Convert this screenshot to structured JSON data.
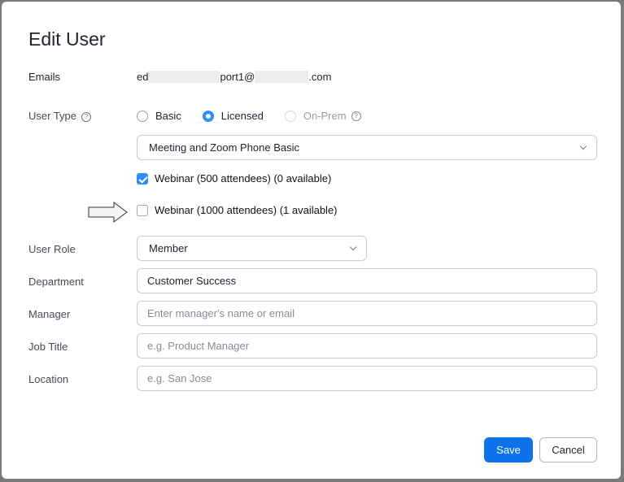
{
  "dialog": {
    "title": "Edit User",
    "emails": {
      "label": "Emails",
      "value_prefix": "ed",
      "value_middle": "port1@",
      "value_suffix": ".com"
    },
    "user_type": {
      "label": "User Type",
      "help": "?",
      "options": [
        {
          "label": "Basic",
          "state": "unchecked"
        },
        {
          "label": "Licensed",
          "state": "checked"
        },
        {
          "label": "On-Prem",
          "state": "disabled"
        }
      ],
      "plan_select": "Meeting and Zoom Phone Basic"
    },
    "addons": [
      {
        "label": "Webinar (500 attendees) (0 available)",
        "checked": true
      },
      {
        "label": "Webinar (1000 attendees) (1 available)",
        "checked": false
      }
    ],
    "user_role": {
      "label": "User Role",
      "value": "Member"
    },
    "department": {
      "label": "Department",
      "value": "Customer Success"
    },
    "manager": {
      "label": "Manager",
      "placeholder": "Enter manager's name or email"
    },
    "job_title": {
      "label": "Job Title",
      "placeholder": "e.g. Product Manager"
    },
    "location": {
      "label": "Location",
      "placeholder": "e.g. San Jose"
    },
    "buttons": {
      "save": "Save",
      "cancel": "Cancel"
    },
    "colors": {
      "primary": "#0e72ed",
      "accent": "#2d8cff"
    }
  }
}
